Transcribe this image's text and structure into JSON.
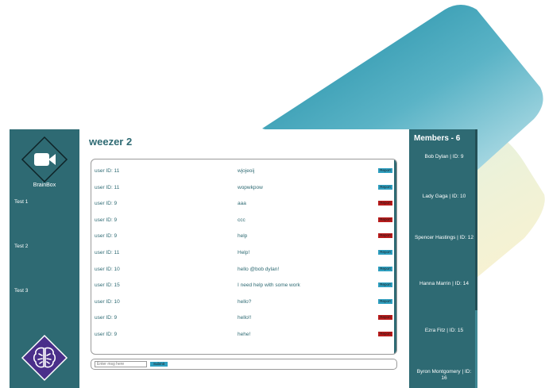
{
  "sidebar": {
    "brand": "BrainBox",
    "items": [
      {
        "label": "Test 1"
      },
      {
        "label": "Test 2"
      },
      {
        "label": "Test 3"
      }
    ]
  },
  "main": {
    "title": "weezer 2",
    "report_label": "Report",
    "messages": [
      {
        "user": "user ID: 11",
        "text": "wjojeoij",
        "report_color": "#2f9fc0"
      },
      {
        "user": "user ID: 11",
        "text": "wopwkpow",
        "report_color": "#2f9fc0"
      },
      {
        "user": "user ID: 9",
        "text": "aaa",
        "report_color": "#b81c1c"
      },
      {
        "user": "user ID: 9",
        "text": "ccc",
        "report_color": "#b81c1c"
      },
      {
        "user": "user ID: 9",
        "text": "help",
        "report_color": "#b81c1c"
      },
      {
        "user": "user ID: 11",
        "text": "Help!",
        "report_color": "#2f9fc0"
      },
      {
        "user": "user ID: 10",
        "text": "hello @bob dylan!",
        "report_color": "#2f9fc0"
      },
      {
        "user": "user ID: 15",
        "text": "I need help with some work",
        "report_color": "#2f9fc0"
      },
      {
        "user": "user ID: 10",
        "text": "hello?",
        "report_color": "#2f9fc0"
      },
      {
        "user": "user ID: 9",
        "text": "hello!!",
        "report_color": "#b81c1c"
      },
      {
        "user": "user ID: 9",
        "text": "hehe!",
        "report_color": "#b81c1c"
      }
    ],
    "compose": {
      "placeholder": "Enter msg here",
      "submit_label": "Submit"
    }
  },
  "members": {
    "title": "Members - 6",
    "list": [
      {
        "label": "Bob Dylan | ID: 9"
      },
      {
        "label": "Lady Gaga | ID: 10"
      },
      {
        "label": "Spencer Hastings | ID: 12"
      },
      {
        "label": "Hanna Marrin | ID: 14"
      },
      {
        "label": "Ezra Fitz | ID: 15"
      },
      {
        "label": "Byron Montgomery | ID: 16"
      }
    ]
  },
  "icons": {
    "logo": "video-camera-icon",
    "footer_logo": "brain-icon"
  },
  "colors": {
    "panel": "#2e6a73",
    "accent": "#2f9fc0",
    "danger": "#b81c1c",
    "brain_tile": "#4a2f8a"
  }
}
